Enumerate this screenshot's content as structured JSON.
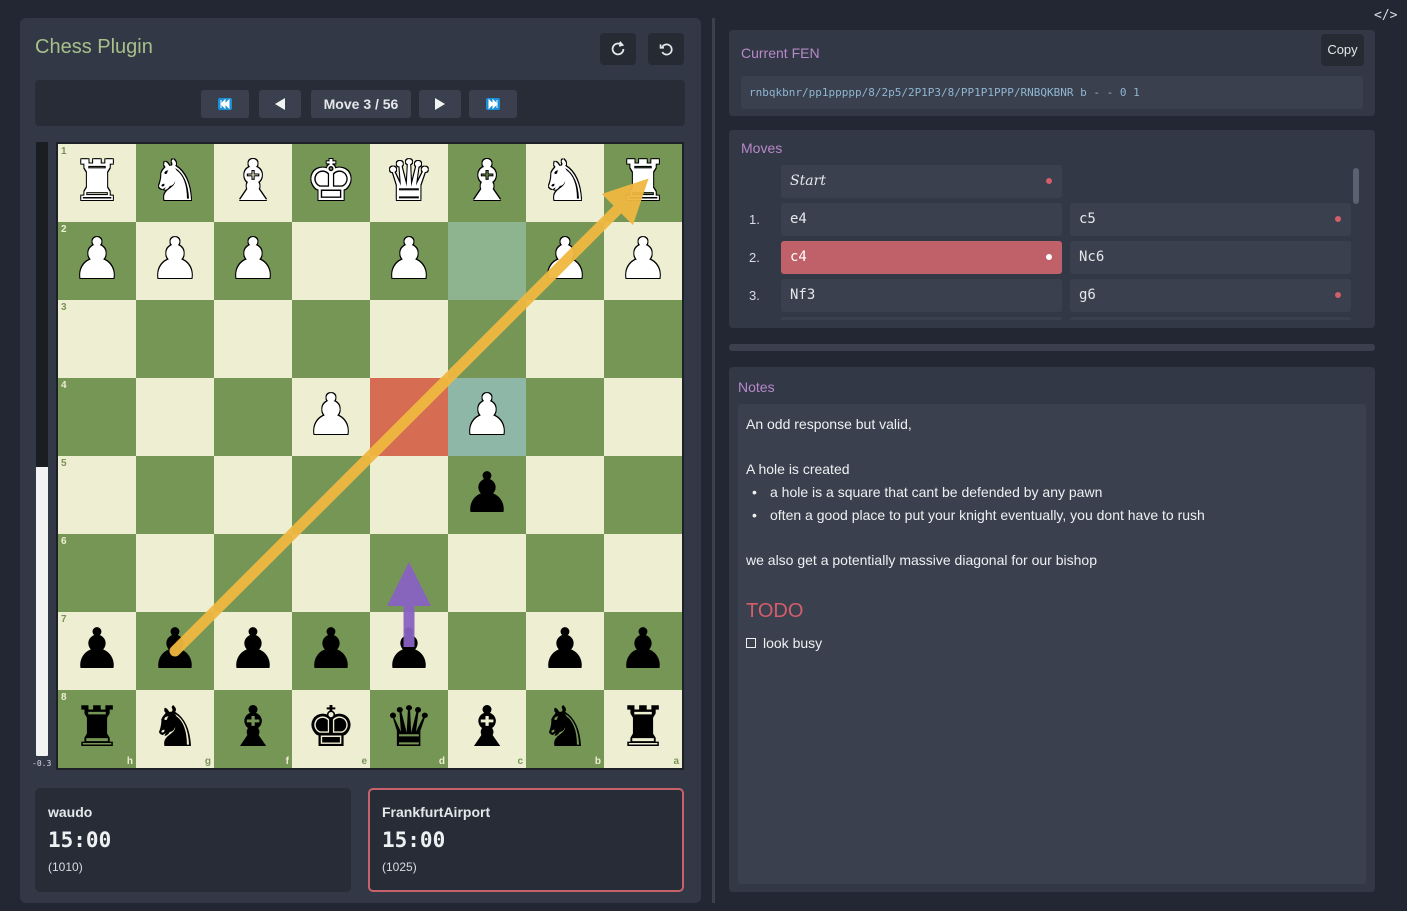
{
  "app": {
    "title": "Chess Plugin"
  },
  "toolbar": {
    "reload_icon": "refresh-icon",
    "reset_icon": "undo-icon"
  },
  "navigation": {
    "first_icon": "skip-first-icon",
    "prev_icon": "prev-icon",
    "move_counter": "Move 3 / 56",
    "next_icon": "next-icon",
    "last_icon": "skip-last-icon"
  },
  "eval": {
    "label": "-0.3",
    "white_fraction": 0.47
  },
  "board": {
    "ranks": [
      "1",
      "2",
      "3",
      "4",
      "5",
      "6",
      "7",
      "8"
    ],
    "files": [
      "h",
      "g",
      "f",
      "e",
      "d",
      "c",
      "b",
      "a"
    ],
    "rows": [
      [
        "♜",
        "♞",
        "♝",
        "♚",
        "♛",
        "♝",
        "♞",
        "♜"
      ],
      [
        "♟",
        "♟",
        "♟",
        "",
        "♟",
        "",
        "♟",
        "♟"
      ],
      [
        "",
        "",
        "",
        "",
        "",
        "",
        "",
        ""
      ],
      [
        "",
        "",
        "",
        "♟",
        "",
        "♟",
        "",
        ""
      ],
      [
        "",
        "",
        "",
        "",
        "",
        "♟",
        "",
        ""
      ],
      [
        "",
        "",
        "",
        "",
        "",
        "",
        "",
        ""
      ],
      [
        "♟",
        "♟",
        "♟",
        "♟",
        "♟",
        "",
        "♟",
        "♟"
      ],
      [
        "♜",
        "♞",
        "♝",
        "♚",
        "♛",
        "♝",
        "♞",
        "♜"
      ]
    ],
    "colors": [
      [
        "w",
        "w",
        "w",
        "w",
        "w",
        "w",
        "w",
        "w"
      ],
      [
        "w",
        "w",
        "w",
        "",
        "w",
        "",
        "w",
        "w"
      ],
      [
        "",
        "",
        "",
        "",
        "",
        "",
        "",
        ""
      ],
      [
        "",
        "",
        "",
        "w",
        "",
        "w",
        "",
        ""
      ],
      [
        "",
        "",
        "",
        "",
        "",
        "b",
        "",
        ""
      ],
      [
        "",
        "",
        "",
        "",
        "",
        "",
        "",
        ""
      ],
      [
        "b",
        "b",
        "b",
        "b",
        "b",
        "",
        "b",
        "b"
      ],
      [
        "b",
        "b",
        "b",
        "b",
        "b",
        "b",
        "b",
        "b"
      ]
    ],
    "highlights": [
      {
        "square": "c2",
        "color": "#8db38f"
      },
      {
        "square": "d4",
        "color": "#d66d53"
      },
      {
        "square": "c4",
        "color": "#8fb7a8"
      }
    ],
    "light_color": "#eeeed2",
    "dark_color": "#769656"
  },
  "players": [
    {
      "name": "waudo",
      "clock": "15:00",
      "rating": "(1010)",
      "active": false
    },
    {
      "name": "FrankfurtAirport",
      "clock": "15:00",
      "rating": "(1025)",
      "active": true
    }
  ],
  "fen": {
    "label": "Current FEN",
    "copy_label": "Copy",
    "value": "rnbqkbnr/pp1ppppp/8/2p5/2P1P3/8/PP1P1PPP/RNBQKBNR b - - 0 1"
  },
  "moves": {
    "label": "Moves",
    "start_label": "Start",
    "rows": [
      {
        "num": "1.",
        "white": "e4",
        "black": "c5",
        "white_dot": false,
        "black_dot": true
      },
      {
        "num": "2.",
        "white": "c4",
        "black": "Nc6",
        "white_dot": true,
        "black_dot": false,
        "selected": "white"
      },
      {
        "num": "3.",
        "white": "Nf3",
        "black": "g6",
        "white_dot": false,
        "black_dot": true
      }
    ]
  },
  "notes": {
    "label": "Notes",
    "line1": "An odd response but valid,",
    "line2": "A hole is created",
    "bullets": [
      "a hole is a square that cant be defended by any pawn",
      "often a good place to put your knight eventually, you dont have to rush"
    ],
    "line3": "we also get a potentially massive diagonal for our bishop",
    "todo_heading": "TODO",
    "todo_item": "look busy"
  },
  "colors": {
    "accent": "#c0616a",
    "title": "#a6c08a",
    "label": "#b889c7",
    "arrow_main": "#f0b840",
    "arrow_alt": "#8a63c2"
  },
  "code_icon": "</>"
}
